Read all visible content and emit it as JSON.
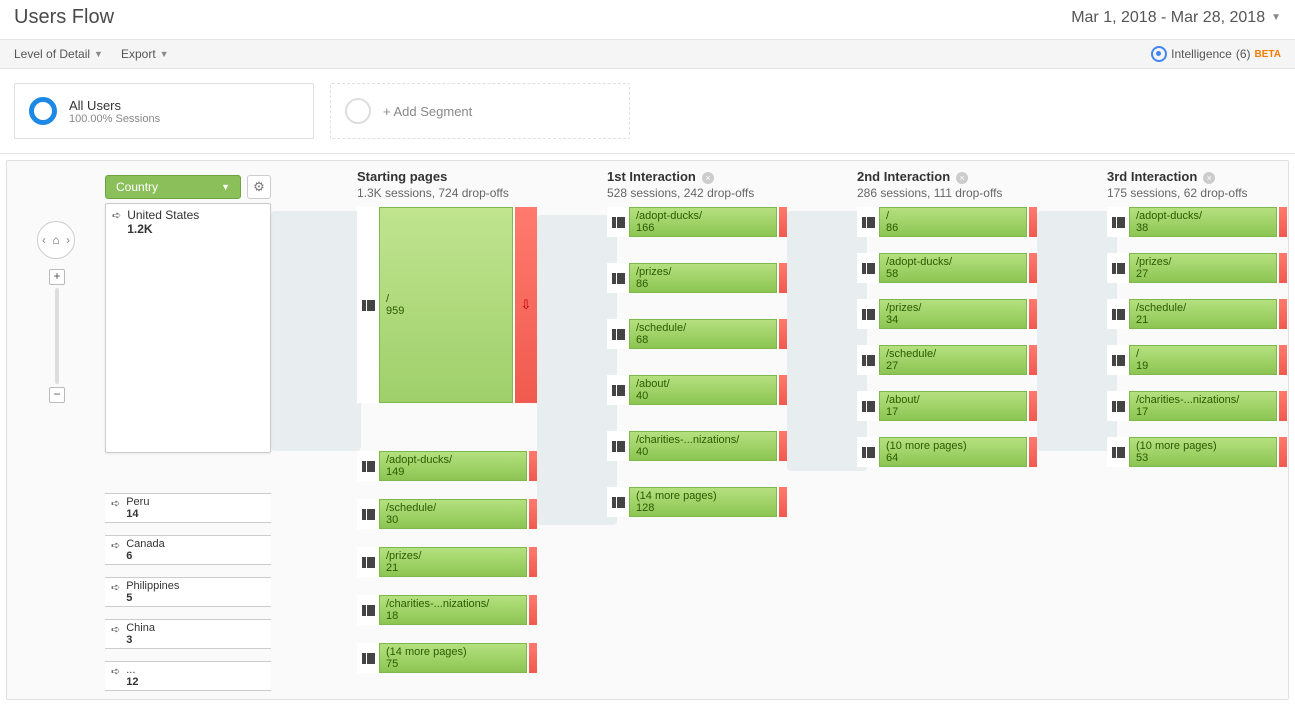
{
  "header": {
    "title": "Users Flow",
    "date_range": "Mar 1, 2018 - Mar 28, 2018"
  },
  "toolbar": {
    "detail": "Level of Detail",
    "export": "Export",
    "intelligence_label": "Intelligence",
    "intelligence_count": "(6)",
    "beta": "BETA"
  },
  "segments": {
    "all_users_title": "All Users",
    "all_users_sub": "100.00% Sessions",
    "add_segment": "+ Add Segment"
  },
  "dimension": {
    "label": "Country"
  },
  "sources": {
    "main": {
      "name": "United States",
      "value": "1.2K"
    },
    "others": [
      {
        "name": "Peru",
        "value": "14"
      },
      {
        "name": "Canada",
        "value": "6"
      },
      {
        "name": "Philippines",
        "value": "5"
      },
      {
        "name": "China",
        "value": "3"
      },
      {
        "name": "...",
        "value": "12"
      }
    ]
  },
  "columns": [
    {
      "title": "Starting pages",
      "sub": "1.3K sessions, 724 drop-offs",
      "closable": false,
      "nodes": [
        {
          "path": "/",
          "value": "959",
          "tall": true
        },
        {
          "path": "/adopt-ducks/",
          "value": "149"
        },
        {
          "path": "/schedule/",
          "value": "30"
        },
        {
          "path": "/prizes/",
          "value": "21"
        },
        {
          "path": "/charities-...nizations/",
          "value": "18"
        },
        {
          "path": "(14 more pages)",
          "value": "75"
        }
      ]
    },
    {
      "title": "1st Interaction",
      "sub": "528 sessions, 242 drop-offs",
      "closable": true,
      "nodes": [
        {
          "path": "/adopt-ducks/",
          "value": "166"
        },
        {
          "path": "/prizes/",
          "value": "86"
        },
        {
          "path": "/schedule/",
          "value": "68"
        },
        {
          "path": "/about/",
          "value": "40"
        },
        {
          "path": "/charities-...nizations/",
          "value": "40"
        },
        {
          "path": "(14 more pages)",
          "value": "128"
        }
      ]
    },
    {
      "title": "2nd Interaction",
      "sub": "286 sessions, 111 drop-offs",
      "closable": true,
      "nodes": [
        {
          "path": "/",
          "value": "86"
        },
        {
          "path": "/adopt-ducks/",
          "value": "58"
        },
        {
          "path": "/prizes/",
          "value": "34"
        },
        {
          "path": "/schedule/",
          "value": "27"
        },
        {
          "path": "/about/",
          "value": "17"
        },
        {
          "path": "(10 more pages)",
          "value": "64"
        }
      ]
    },
    {
      "title": "3rd Interaction",
      "sub": "175 sessions, 62 drop-offs",
      "closable": true,
      "nodes": [
        {
          "path": "/adopt-ducks/",
          "value": "38"
        },
        {
          "path": "/prizes/",
          "value": "27"
        },
        {
          "path": "/schedule/",
          "value": "21"
        },
        {
          "path": "/",
          "value": "19"
        },
        {
          "path": "/charities-...nizations/",
          "value": "17"
        },
        {
          "path": "(10 more pages)",
          "value": "53"
        }
      ]
    }
  ]
}
